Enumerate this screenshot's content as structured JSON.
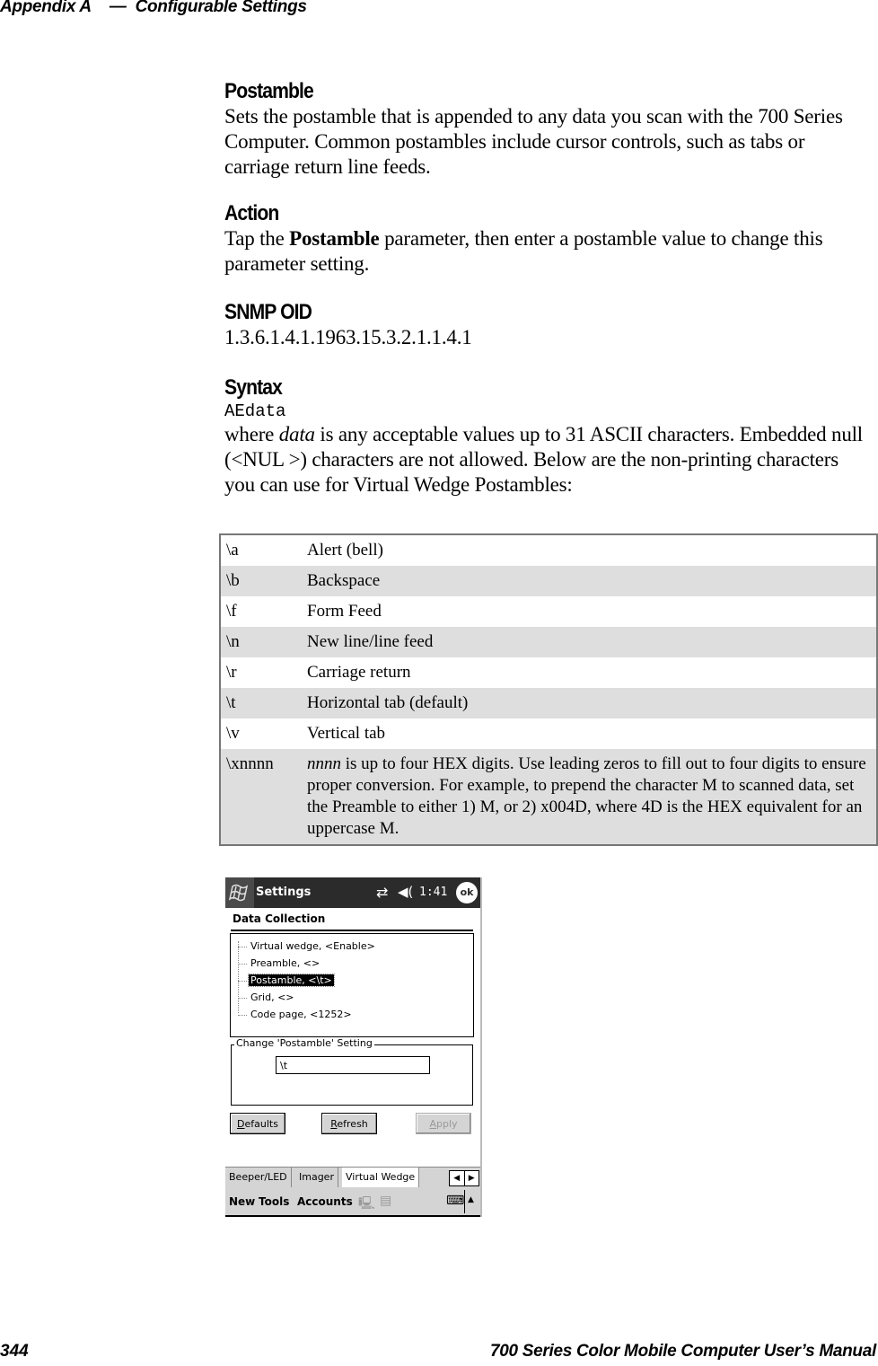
{
  "header": {
    "appendix": "Appendix A",
    "dash": "—",
    "chapter": "Configurable Settings"
  },
  "sections": {
    "postamble": {
      "heading": "Postamble",
      "body": "Sets the postamble that is appended to any data you scan with the 700 Series Computer. Common postambles include cursor controls, such as tabs or carriage return line feeds."
    },
    "action": {
      "heading": "Action",
      "body_prefix": "Tap the ",
      "body_bold": "Postamble",
      "body_suffix": " parameter, then enter a postamble value to change this parameter setting."
    },
    "snmp": {
      "heading": "SNMP OID",
      "oid": "1.3.6.1.4.1.1963.15.3.2.1.1.4.1"
    },
    "syntax": {
      "heading": "Syntax",
      "code": "AEdata",
      "body_prefix": "where ",
      "body_italic": "data",
      "body_suffix": " is any acceptable values up to 31 ASCII characters. Embedded null (<NUL >) characters are not allowed. Below are the non-printing characters you can use for Virtual Wedge Postambles:"
    }
  },
  "codes_table": {
    "rows": [
      {
        "code": "\\a",
        "desc": "Alert (bell)"
      },
      {
        "code": "\\b",
        "desc": "Backspace"
      },
      {
        "code": "\\f",
        "desc": "Form Feed"
      },
      {
        "code": "\\n",
        "desc": "New line/line feed"
      },
      {
        "code": "\\r",
        "desc": "Carriage return"
      },
      {
        "code": "\\t",
        "desc": "Horizontal tab (default)"
      },
      {
        "code": "\\v",
        "desc": "Vertical tab"
      },
      {
        "code": "\\xnnnn",
        "desc_italic": "nnnn",
        "desc": " is up to four HEX digits. Use leading zeros to fill out to four digits to ensure proper conversion. For example, to prepend the character M to scanned data, set the Preamble to either 1) M, or 2) x004D, where 4D is the HEX equivalent for an uppercase M."
      }
    ]
  },
  "device": {
    "titlebar": {
      "start_icon": "windows-flag-icon",
      "title": "Settings",
      "sync_icon": "⇄",
      "speaker_icon": "◀(",
      "time": "1:41",
      "ok_label": "ok"
    },
    "section_title": "Data Collection",
    "tree_items": [
      {
        "label": "Virtual wedge, <Enable>",
        "selected": false
      },
      {
        "label": "Preamble, <>",
        "selected": false
      },
      {
        "label": "Postamble, <\\t>",
        "selected": true
      },
      {
        "label": "Grid, <>",
        "selected": false
      },
      {
        "label": "Code page, <1252>",
        "selected": false
      }
    ],
    "groupbox": {
      "legend": "Change 'Postamble' Setting",
      "value": "\\t"
    },
    "buttons": {
      "defaults": "Defaults",
      "refresh": "Refresh",
      "apply": "Apply"
    },
    "tabs": [
      "Beeper/LED",
      "Imager",
      "Virtual Wedge"
    ],
    "tab_arrows": {
      "left": "◀",
      "right": "▶"
    },
    "menubar": {
      "new": "New",
      "tools": "Tools",
      "accounts": "Accounts",
      "icon1": "🖳",
      "icon2": "▤",
      "keyboard": "⌨",
      "up": "▲"
    }
  },
  "footer": {
    "page_number": "344",
    "manual_title": "700 Series Color Mobile Computer User’s Manual"
  }
}
